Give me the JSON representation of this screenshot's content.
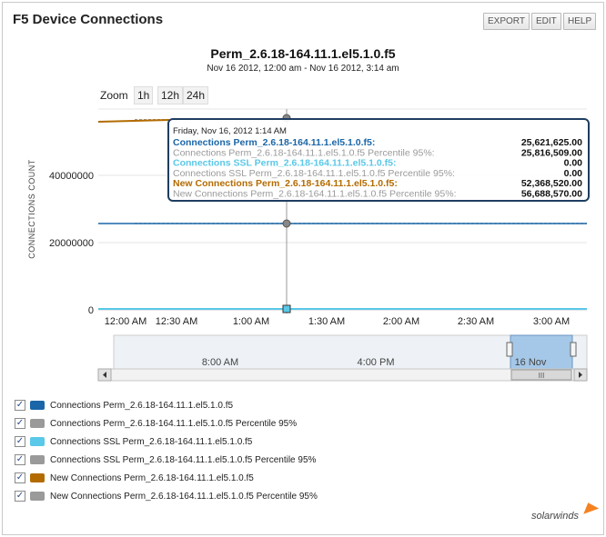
{
  "header": {
    "title": "F5 Device Connections",
    "export_label": "EXPORT",
    "edit_label": "EDIT",
    "help_label": "HELP"
  },
  "chart": {
    "title": "Perm_2.6.18-164.11.1.el5.1.0.f5",
    "subtitle": "Nov 16 2012, 12:00 am - Nov 16 2012, 3:14 am",
    "zoom": {
      "label": "Zoom",
      "options": [
        "1h",
        "12h",
        "24h"
      ]
    },
    "ylabel": "CONNECTIONS COUNT",
    "y_ticks": [
      "0",
      "20000000",
      "40000000"
    ],
    "x_ticks": [
      "12:00 AM",
      "12:30 AM",
      "1:00 AM",
      "1:30 AM",
      "2:00 AM",
      "2:30 AM",
      "3:00 AM"
    ]
  },
  "tooltip": {
    "date": "Friday, Nov 16, 2012 1:14 AM",
    "rows": [
      {
        "label": "Connections Perm_2.6.18-164.11.1.el5.1.0.f5:",
        "value": "25,621,625.00",
        "color": "#1a66a8",
        "bold": true
      },
      {
        "label": "Connections Perm_2.6.18-164.11.1.el5.1.0.f5 Percentile 95%:",
        "value": "25,816,509.00",
        "color": "#9a9a9a",
        "bold": false
      },
      {
        "label": "Connections SSL Perm_2.6.18-164.11.1.el5.1.0.f5:",
        "value": "0.00",
        "color": "#5ac8e8",
        "bold": true
      },
      {
        "label": "Connections SSL Perm_2.6.18-164.11.1.el5.1.0.f5 Percentile 95%:",
        "value": "0.00",
        "color": "#9a9a9a",
        "bold": false
      },
      {
        "label": "New Connections Perm_2.6.18-164.11.1.el5.1.0.f5:",
        "value": "52,368,520.00",
        "color": "#b36b00",
        "bold": true
      },
      {
        "label": "New Connections Perm_2.6.18-164.11.1.el5.1.0.f5 Percentile 95%:",
        "value": "56,688,570.00",
        "color": "#9a9a9a",
        "bold": false
      }
    ]
  },
  "navigator": {
    "labels": [
      "8:00 AM",
      "4:00 PM",
      "16 Nov"
    ],
    "scroll_grip": "III"
  },
  "legend": [
    {
      "label": "Connections Perm_2.6.18-164.11.1.el5.1.0.f5",
      "color": "#1a66a8",
      "checked": true
    },
    {
      "label": "Connections Perm_2.6.18-164.11.1.el5.1.0.f5 Percentile 95%",
      "color": "#9a9a9a",
      "checked": true
    },
    {
      "label": "Connections SSL Perm_2.6.18-164.11.1.el5.1.0.f5",
      "color": "#5ac8e8",
      "checked": true
    },
    {
      "label": "Connections SSL Perm_2.6.18-164.11.1.el5.1.0.f5 Percentile 95%",
      "color": "#9a9a9a",
      "checked": true
    },
    {
      "label": "New Connections Perm_2.6.18-164.11.1.el5.1.0.f5",
      "color": "#b36b00",
      "checked": true
    },
    {
      "label": "New Connections Perm_2.6.18-164.11.1.el5.1.0.f5 Percentile 95%",
      "color": "#9a9a9a",
      "checked": true
    }
  ],
  "footer": {
    "brand": "solarwinds"
  },
  "chart_data": {
    "type": "line",
    "ylabel": "CONNECTIONS COUNT",
    "ylim": [
      0,
      50000000
    ],
    "x_range": [
      "12:00 AM",
      "3:14 AM"
    ],
    "grid": "horizontal",
    "series": [
      {
        "name": "Connections Perm_2.6.18-164.11.1.el5.1.0.f5",
        "color": "#1a66a8",
        "values": [
          25621625,
          25621625
        ]
      },
      {
        "name": "Connections Perm_2.6.18-164.11.1.el5.1.0.f5 Percentile 95%",
        "color": "#9a9a9a",
        "values": [
          25816509,
          25816509
        ]
      },
      {
        "name": "Connections SSL Perm_2.6.18-164.11.1.el5.1.0.f5",
        "color": "#5ac8e8",
        "values": [
          0,
          0
        ]
      },
      {
        "name": "Connections SSL Perm_2.6.18-164.11.1.el5.1.0.f5 Percentile 95%",
        "color": "#9a9a9a",
        "values": [
          0,
          0
        ]
      },
      {
        "name": "New Connections Perm_2.6.18-164.11.1.el5.1.0.f5",
        "color": "#b36b00",
        "values": [
          52368520,
          52368520
        ]
      },
      {
        "name": "New Connections Perm_2.6.18-164.11.1.el5.1.0.f5 Percentile 95%",
        "color": "#9a9a9a",
        "values": [
          56688570,
          56688570
        ]
      }
    ]
  }
}
